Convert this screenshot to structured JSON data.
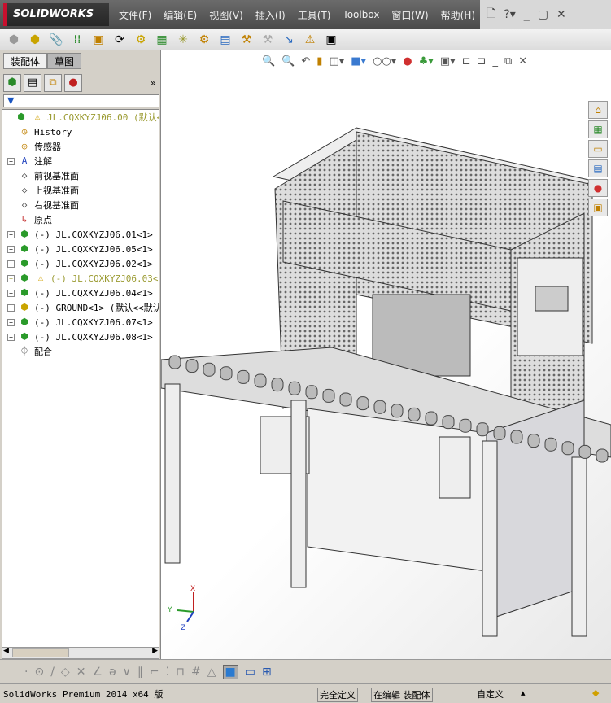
{
  "app": {
    "logo": "SOLIDWORKS"
  },
  "menu": [
    "文件(F)",
    "编辑(E)",
    "视图(V)",
    "插入(I)",
    "工具(T)",
    "Toolbox",
    "窗口(W)",
    "帮助(H)"
  ],
  "left_panel": {
    "tabs": [
      "装配体",
      "草图"
    ],
    "tree": [
      {
        "label": "JL.CQXKYZJ06.00  (默认<默认",
        "icon": "assembly-icon",
        "warning": true,
        "expand": false,
        "level": 0
      },
      {
        "label": "History",
        "icon": "history-icon",
        "expand": false,
        "level": 1
      },
      {
        "label": "传感器",
        "icon": "sensor-icon",
        "expand": false,
        "level": 1
      },
      {
        "label": "注解",
        "icon": "annotation-icon",
        "expand": true,
        "level": 1
      },
      {
        "label": "前视基准面",
        "icon": "plane-icon",
        "expand": false,
        "level": 1
      },
      {
        "label": "上视基准面",
        "icon": "plane-icon",
        "expand": false,
        "level": 1
      },
      {
        "label": "右视基准面",
        "icon": "plane-icon",
        "expand": false,
        "level": 1
      },
      {
        "label": "原点",
        "icon": "origin-icon",
        "expand": false,
        "level": 1
      },
      {
        "label": "(-) JL.CQXKYZJ06.01<1> (默",
        "icon": "assembly-icon",
        "expand": true,
        "level": 1
      },
      {
        "label": "(-) JL.CQXKYZJ06.05<1> (默",
        "icon": "assembly-icon",
        "expand": true,
        "level": 1
      },
      {
        "label": "(-) JL.CQXKYZJ06.02<1> (默",
        "icon": "assembly-icon",
        "expand": true,
        "level": 1
      },
      {
        "label": "(-) JL.CQXKYZJ06.03<1>",
        "icon": "assembly-icon",
        "warning": true,
        "expand": true,
        "level": 1
      },
      {
        "label": "(-) JL.CQXKYZJ06.04<1> (默",
        "icon": "assembly-icon",
        "expand": true,
        "level": 1
      },
      {
        "label": "(-) GROUND<1> (默认<<默认",
        "icon": "part-icon",
        "expand": true,
        "level": 1
      },
      {
        "label": "(-) JL.CQXKYZJ06.07<1> (默",
        "icon": "assembly-icon",
        "expand": true,
        "level": 1
      },
      {
        "label": "(-) JL.CQXKYZJ06.08<1> (默",
        "icon": "assembly-icon",
        "expand": true,
        "level": 1
      },
      {
        "label": "配合",
        "icon": "mates-icon",
        "expand": false,
        "level": 1
      }
    ]
  },
  "triad": {
    "x": "X",
    "y": "Y",
    "z": "Z"
  },
  "status": {
    "product": "SolidWorks Premium 2014 x64 版",
    "defined": "完全定义",
    "editing": "在编辑 装配体",
    "units": "自定义"
  }
}
